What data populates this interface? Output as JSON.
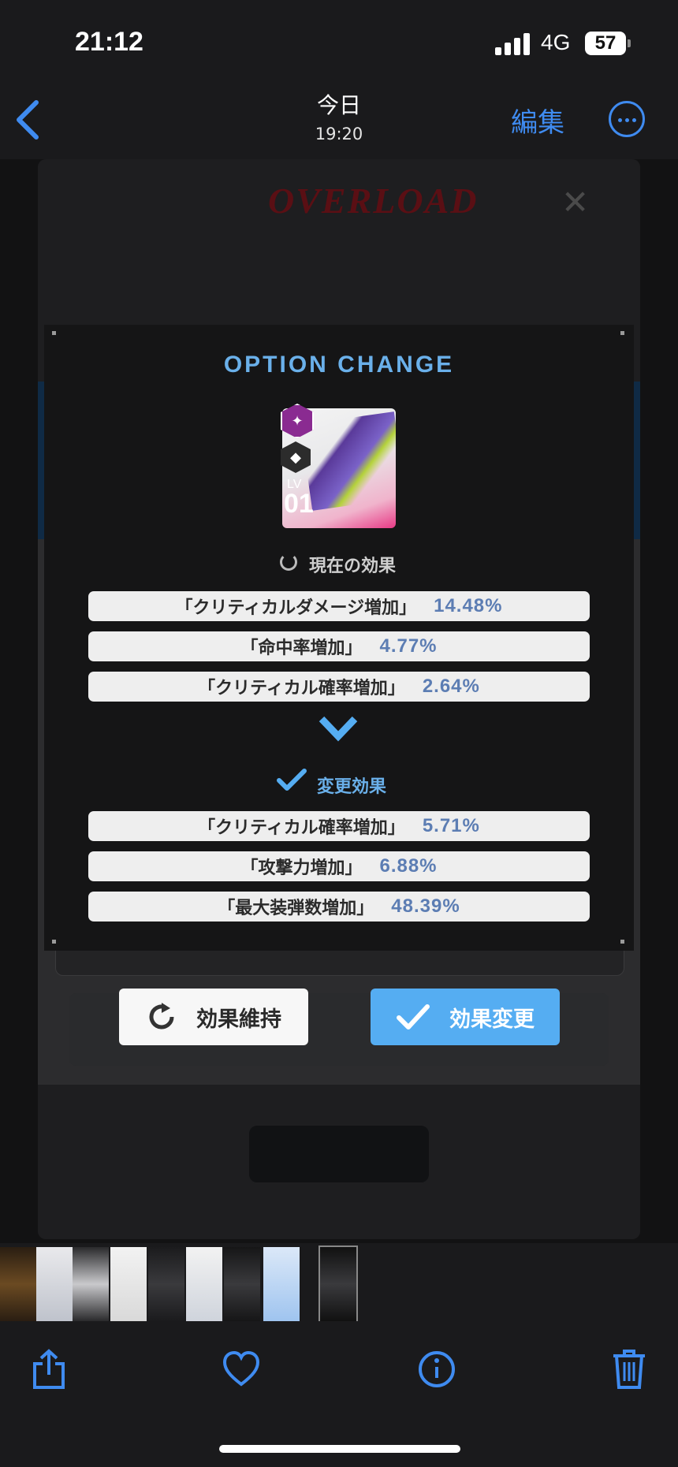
{
  "status_bar": {
    "time": "21:12",
    "network": "4G",
    "battery": "57"
  },
  "nav": {
    "title": "今日",
    "subtitle": "19:20",
    "edit_label": "編集"
  },
  "background_game": {
    "title": "OVERLOAD"
  },
  "dialog": {
    "title": "OPTION CHANGE",
    "item": {
      "lv_label": "LV",
      "lv_value": "01"
    },
    "current_section": {
      "label": "現在の効果",
      "effects": [
        {
          "name": "「クリティカルダメージ増加」",
          "value": "14.48%"
        },
        {
          "name": "「命中率増加」",
          "value": "4.77%"
        },
        {
          "name": "「クリティカル確率増加」",
          "value": "2.64%"
        }
      ]
    },
    "new_section": {
      "label": "変更効果",
      "effects": [
        {
          "name": "「クリティカル確率増加」",
          "value": "5.71%"
        },
        {
          "name": "「攻撃力増加」",
          "value": "6.88%"
        },
        {
          "name": "「最大装弾数増加」",
          "value": "48.39%"
        }
      ]
    },
    "buttons": {
      "keep": "効果維持",
      "change": "効果変更"
    }
  },
  "colors": {
    "accent_blue": "#55adf2",
    "ios_blue": "#3f8bf0",
    "title_blue": "#6ab0ea",
    "item_pink": "#e83a86"
  },
  "toolbar": {
    "icons": [
      "share-icon",
      "heart-icon",
      "info-icon",
      "trash-icon"
    ]
  }
}
